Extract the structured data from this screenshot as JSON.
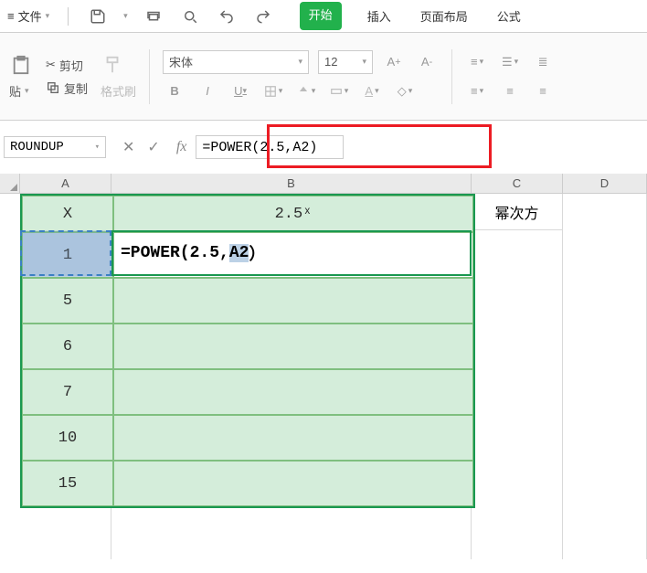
{
  "tabs": {
    "file": "文件",
    "start": "开始",
    "insert": "插入",
    "layout": "页面布局",
    "formulas": "公式"
  },
  "ribbon": {
    "cut": "剪切",
    "copy": "复制",
    "paste": "贴",
    "format_painter": "格式刷",
    "font_name": "宋体",
    "font_size": "12",
    "bold": "B",
    "italic": "I",
    "underline": "U"
  },
  "formula_bar": {
    "name_box": "ROUNDUP",
    "fx": "fx",
    "formula": "=POWER(2.5,A2)"
  },
  "columns": {
    "A": "A",
    "B": "B",
    "C": "C",
    "D": "D"
  },
  "table": {
    "headers": {
      "x": "X",
      "expo": "2.5ˣ",
      "label": "幂次方"
    },
    "col_a": [
      "1",
      "5",
      "6",
      "7",
      "10",
      "15"
    ],
    "edit_prefix": "=POWER(2.5,",
    "edit_ref": "A2",
    "edit_suffix": "）"
  }
}
